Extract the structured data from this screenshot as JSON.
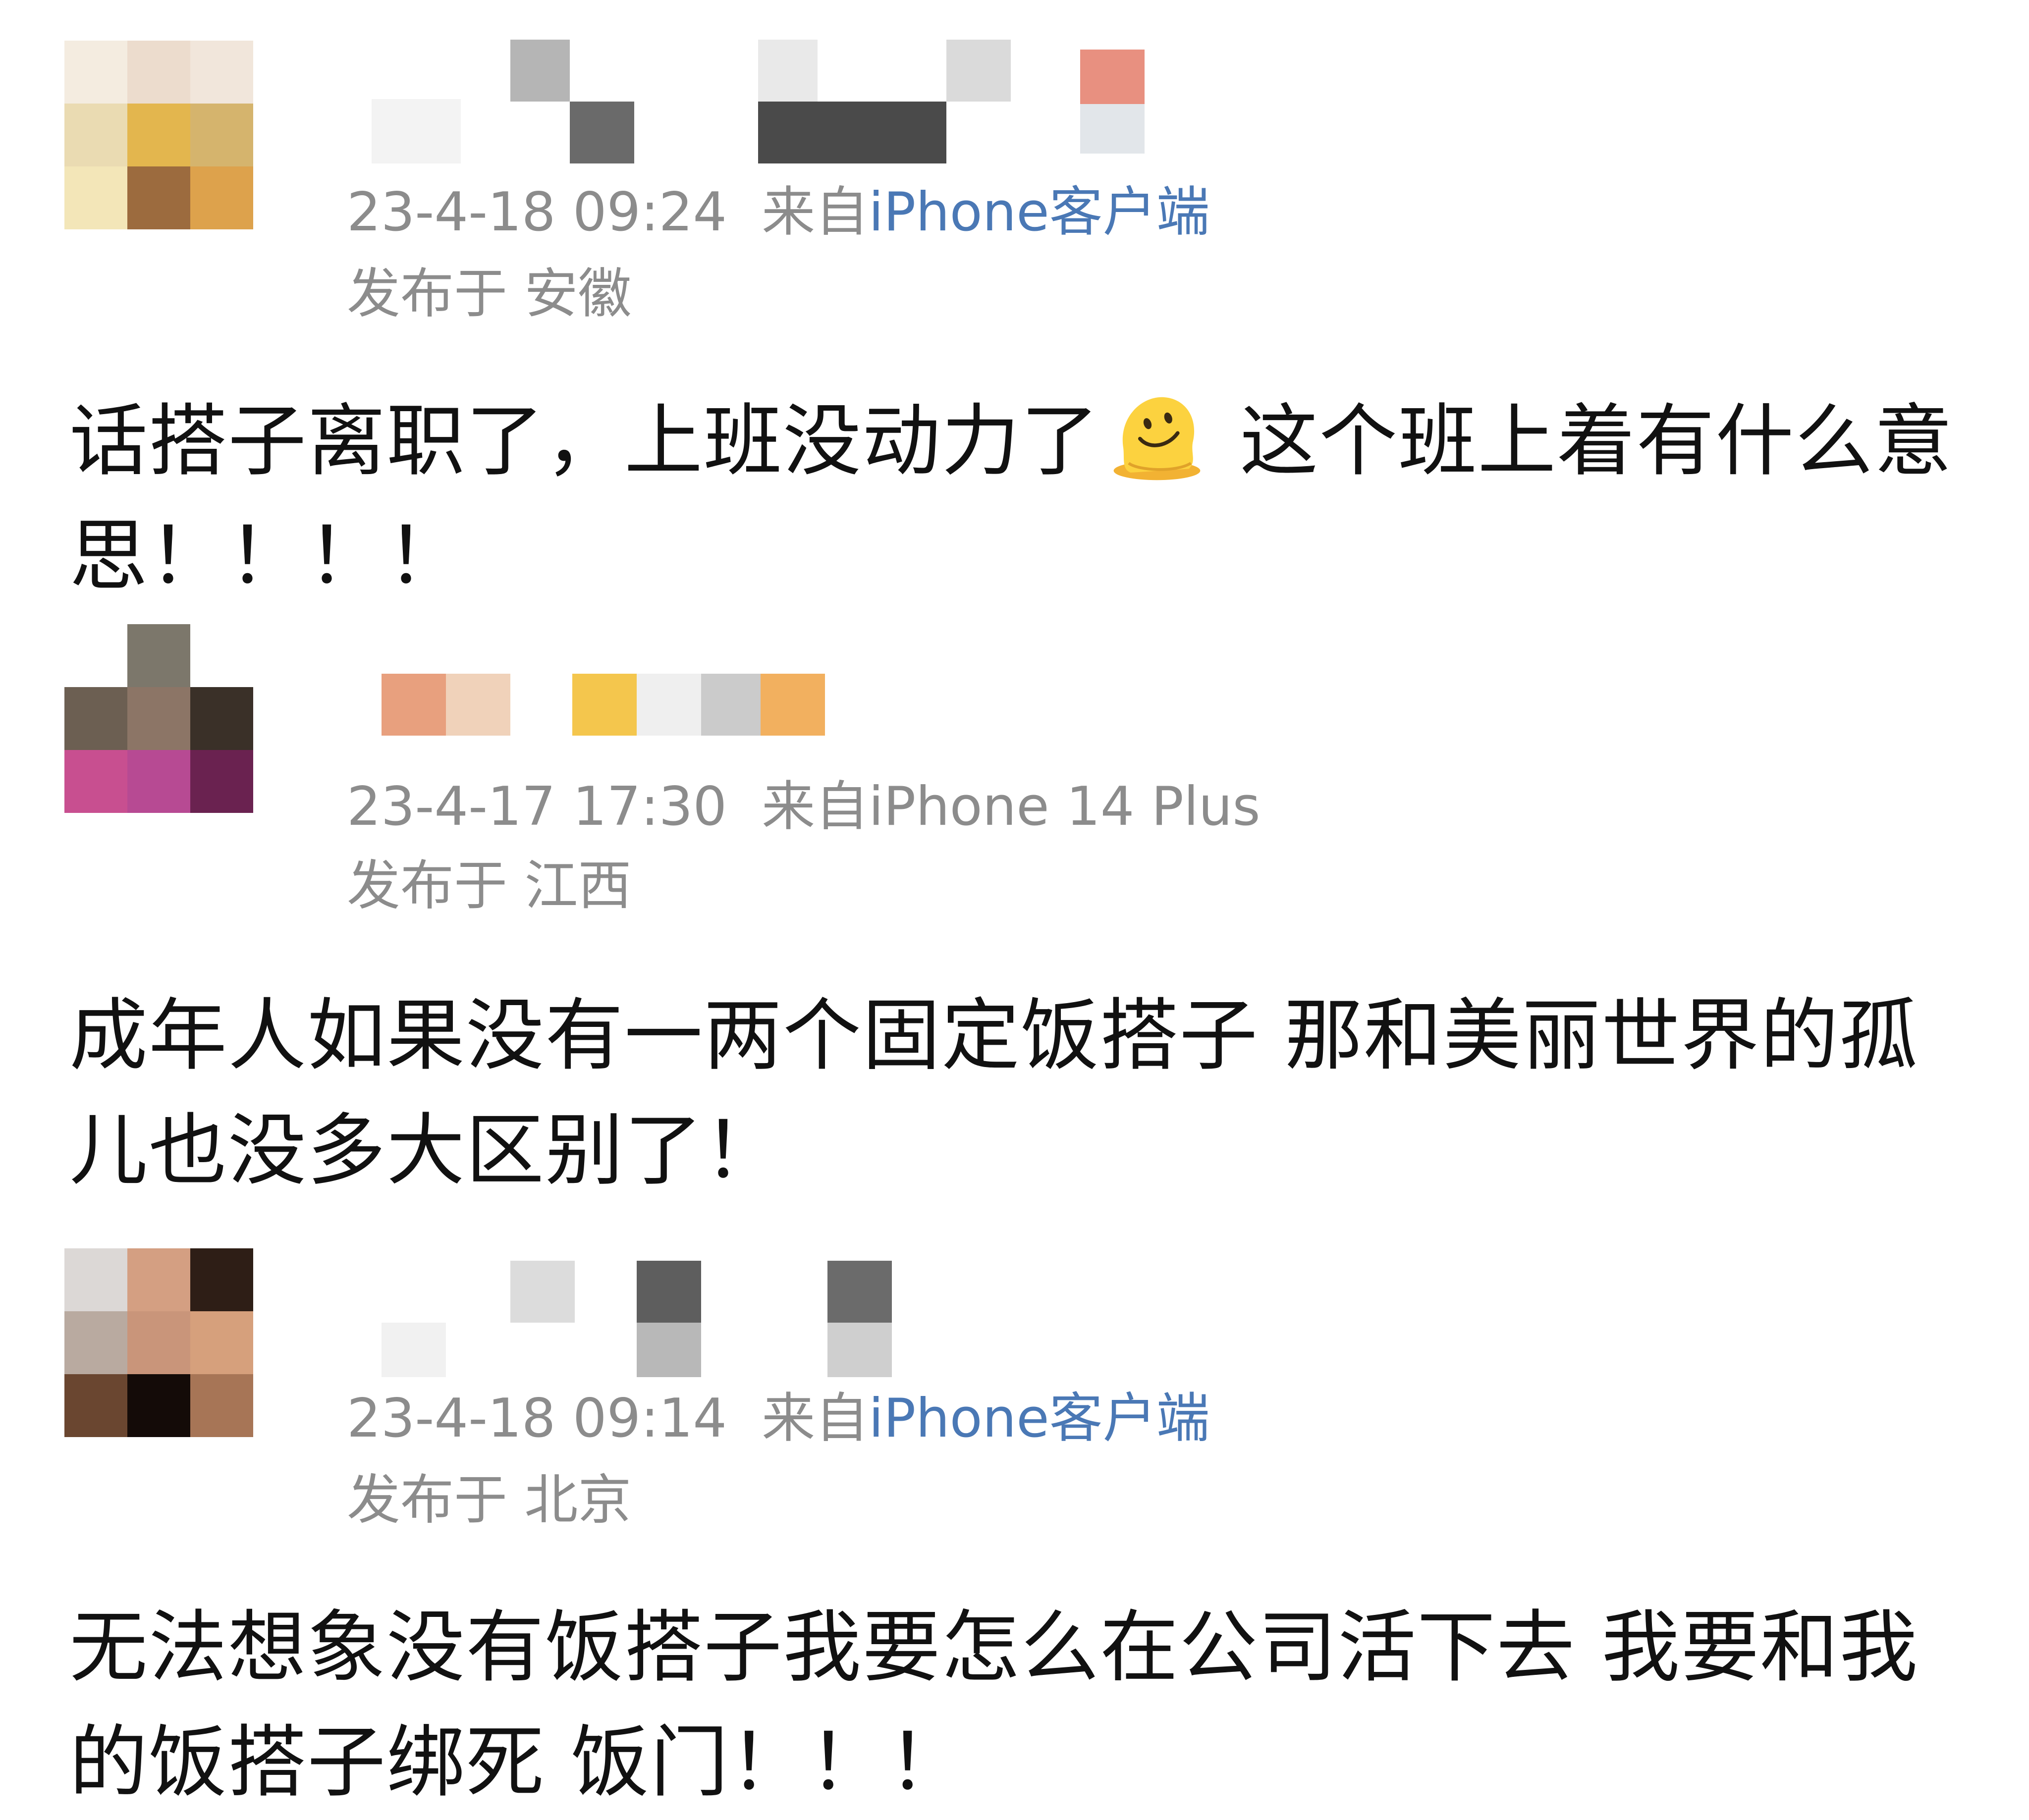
{
  "comments": [
    {
      "timestamp": "23-4-18 09:24",
      "source_prefix": "来自",
      "source_name": "iPhone客户端",
      "location": "发布于 安徽",
      "text_before_emoji": "话搭子离职了，上班没动力了",
      "emoji": "melting-face-emoji",
      "text_after_emoji": " 这个班上着有什么意思！！！！",
      "avatar_colors": [
        "#f4ece0",
        "#ecdccd",
        "#f1e6db",
        "#eadbb2",
        "#e3b64e",
        "#d5b46d",
        "#f3e6b8",
        "#9c6b3e",
        "#dda24c"
      ],
      "username_blocks": [
        "#f3f3f3",
        "#b5b5b5",
        "#6a6a6a",
        "#e9e9e9",
        "#4a4a4a",
        "#dadada",
        "#e89080",
        "#e2e6ea"
      ]
    },
    {
      "timestamp": "23-4-17 17:30",
      "source_prefix": "来自",
      "source_name": "iPhone 14 Plus",
      "location": "发布于 江西",
      "text": "成年人如果没有一两个固定饭搭子 那和美丽世界的孤儿也没多大区别了！",
      "avatar_colors": [
        "#ffffff",
        "#7c776b",
        "#ffffff",
        "#6c5f52",
        "#8c7566",
        "#3a3028",
        "#c84f90",
        "#b74a93",
        "#6a2250"
      ],
      "username_blocks": [
        "#e8a07e",
        "#f0d2ba",
        "#f4c64d",
        "#efefef",
        "#cbcbcb",
        "#f2b05f"
      ]
    },
    {
      "timestamp": "23-4-18 09:14",
      "source_prefix": "来自",
      "source_name": "iPhone客户端",
      "location": "发布于 北京",
      "text": "无法想象没有饭搭子我要怎么在公司活下去  我要和我的饭搭子绑死  饭门！！！",
      "avatar_colors": [
        "#dcd8d6",
        "#d49f82",
        "#2e1e16",
        "#b9aaa0",
        "#c9957a",
        "#d6a07c",
        "#6a4630",
        "#140b08",
        "#a77556"
      ],
      "username_blocks": [
        "#f1f1f1",
        "#dcdcdc",
        "#5e5e5e",
        "#b8b8b8",
        "#6b6b6b",
        "#cfcfcf"
      ]
    }
  ]
}
